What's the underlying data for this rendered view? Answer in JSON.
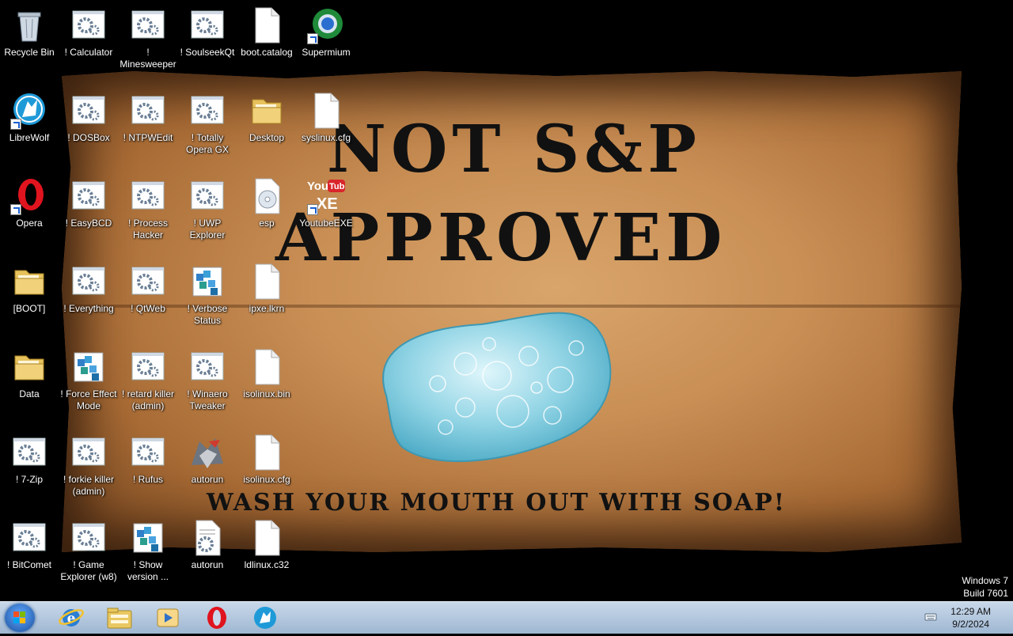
{
  "wallpaper": {
    "line1": "NOT S&P",
    "line2": "APPROVED",
    "line3": "WASH YOUR MOUTH OUT WITH SOAP!"
  },
  "desktop_icons": [
    {
      "label": "Recycle Bin",
      "icon": "recycle-bin-icon"
    },
    {
      "label": "! Calculator",
      "icon": "script-gear-icon"
    },
    {
      "label": "! Minesweeper",
      "icon": "script-gear-icon"
    },
    {
      "label": "! SoulseekQt",
      "icon": "script-gear-icon"
    },
    {
      "label": "boot.catalog",
      "icon": "file-icon"
    },
    {
      "label": "Supermium",
      "icon": "supermium-icon"
    },
    {
      "label": "LibreWolf",
      "icon": "librewolf-icon"
    },
    {
      "label": "! DOSBox",
      "icon": "script-gear-icon"
    },
    {
      "label": "! NTPWEdit",
      "icon": "script-gear-icon"
    },
    {
      "label": "! Totally Opera GX",
      "icon": "script-gear-icon"
    },
    {
      "label": "Desktop",
      "icon": "folder-icon"
    },
    {
      "label": "syslinux.cfg",
      "icon": "file-icon"
    },
    {
      "label": "Opera",
      "icon": "opera-icon"
    },
    {
      "label": "! EasyBCD",
      "icon": "script-gear-icon"
    },
    {
      "label": "! Process Hacker",
      "icon": "script-gear-icon"
    },
    {
      "label": "! UWP Explorer",
      "icon": "script-gear-icon"
    },
    {
      "label": "esp",
      "icon": "disc-icon"
    },
    {
      "label": "YoutubeEXE",
      "icon": "youtube-exe-icon"
    },
    {
      "label": "[BOOT]",
      "icon": "folder-icon"
    },
    {
      "label": "! Everything",
      "icon": "script-gear-icon"
    },
    {
      "label": "! QtWeb",
      "icon": "script-gear-icon"
    },
    {
      "label": "! Verbose Status",
      "icon": "registry-icon"
    },
    {
      "label": "ipxe.lkrn",
      "icon": "file-icon"
    },
    {
      "label": "Data",
      "icon": "folder-icon"
    },
    {
      "label": "! Force Effect Mode",
      "icon": "registry-icon"
    },
    {
      "label": "! retard killer (admin)",
      "icon": "script-gear-icon"
    },
    {
      "label": "! Winaero Tweaker",
      "icon": "script-gear-icon"
    },
    {
      "label": "isolinux.bin",
      "icon": "file-icon"
    },
    {
      "label": "! 7-Zip",
      "icon": "script-gear-icon"
    },
    {
      "label": "! forkie killer (admin)",
      "icon": "script-gear-icon"
    },
    {
      "label": "! Rufus",
      "icon": "script-gear-icon"
    },
    {
      "label": "autorun",
      "icon": "autorun-icon"
    },
    {
      "label": "isolinux.cfg",
      "icon": "file-icon"
    },
    {
      "label": "! BitComet",
      "icon": "script-gear-icon"
    },
    {
      "label": "! Game Explorer (w8)",
      "icon": "script-gear-icon"
    },
    {
      "label": "! Show version ...",
      "icon": "registry-icon"
    },
    {
      "label": "autorun",
      "icon": "settings-file-icon"
    },
    {
      "label": "ldlinux.c32",
      "icon": "file-icon"
    }
  ],
  "watermark": {
    "line1": "Windows 7",
    "line2": "Build 7601"
  },
  "taskbar": {
    "start_icon": "windows-start-icon",
    "apps": [
      {
        "name": "Internet Explorer",
        "icon": "internet-explorer-icon"
      },
      {
        "name": "Windows Explorer",
        "icon": "file-explorer-icon"
      },
      {
        "name": "Windows Media Player",
        "icon": "media-player-icon"
      },
      {
        "name": "Opera",
        "icon": "opera-icon"
      },
      {
        "name": "LibreWolf",
        "icon": "librewolf-icon"
      }
    ],
    "tray_icon": "keyboard-icon",
    "time": "12:29 AM",
    "date": "9/2/2024"
  }
}
